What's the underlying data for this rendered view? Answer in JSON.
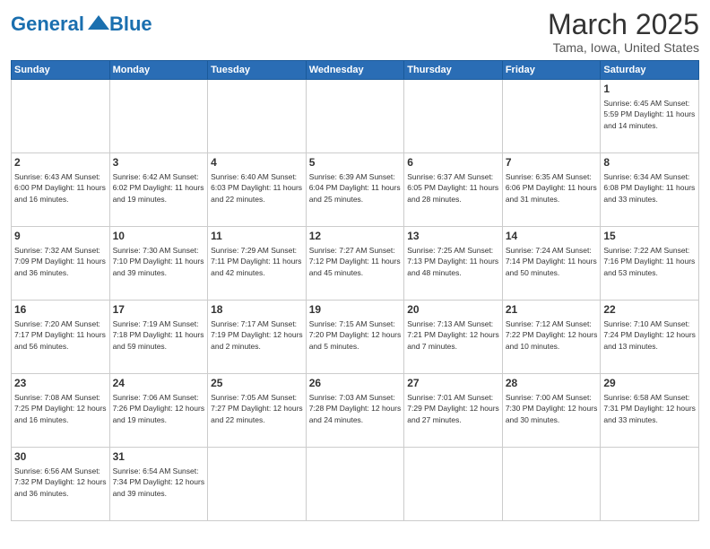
{
  "header": {
    "logo_text_normal": "General",
    "logo_text_blue": "Blue",
    "month_title": "March 2025",
    "location": "Tama, Iowa, United States"
  },
  "weekdays": [
    "Sunday",
    "Monday",
    "Tuesday",
    "Wednesday",
    "Thursday",
    "Friday",
    "Saturday"
  ],
  "weeks": [
    [
      {
        "day": "",
        "content": ""
      },
      {
        "day": "",
        "content": ""
      },
      {
        "day": "",
        "content": ""
      },
      {
        "day": "",
        "content": ""
      },
      {
        "day": "",
        "content": ""
      },
      {
        "day": "",
        "content": ""
      },
      {
        "day": "1",
        "content": "Sunrise: 6:45 AM\nSunset: 5:59 PM\nDaylight: 11 hours and 14 minutes."
      }
    ],
    [
      {
        "day": "2",
        "content": "Sunrise: 6:43 AM\nSunset: 6:00 PM\nDaylight: 11 hours and 16 minutes."
      },
      {
        "day": "3",
        "content": "Sunrise: 6:42 AM\nSunset: 6:02 PM\nDaylight: 11 hours and 19 minutes."
      },
      {
        "day": "4",
        "content": "Sunrise: 6:40 AM\nSunset: 6:03 PM\nDaylight: 11 hours and 22 minutes."
      },
      {
        "day": "5",
        "content": "Sunrise: 6:39 AM\nSunset: 6:04 PM\nDaylight: 11 hours and 25 minutes."
      },
      {
        "day": "6",
        "content": "Sunrise: 6:37 AM\nSunset: 6:05 PM\nDaylight: 11 hours and 28 minutes."
      },
      {
        "day": "7",
        "content": "Sunrise: 6:35 AM\nSunset: 6:06 PM\nDaylight: 11 hours and 31 minutes."
      },
      {
        "day": "8",
        "content": "Sunrise: 6:34 AM\nSunset: 6:08 PM\nDaylight: 11 hours and 33 minutes."
      }
    ],
    [
      {
        "day": "9",
        "content": "Sunrise: 7:32 AM\nSunset: 7:09 PM\nDaylight: 11 hours and 36 minutes."
      },
      {
        "day": "10",
        "content": "Sunrise: 7:30 AM\nSunset: 7:10 PM\nDaylight: 11 hours and 39 minutes."
      },
      {
        "day": "11",
        "content": "Sunrise: 7:29 AM\nSunset: 7:11 PM\nDaylight: 11 hours and 42 minutes."
      },
      {
        "day": "12",
        "content": "Sunrise: 7:27 AM\nSunset: 7:12 PM\nDaylight: 11 hours and 45 minutes."
      },
      {
        "day": "13",
        "content": "Sunrise: 7:25 AM\nSunset: 7:13 PM\nDaylight: 11 hours and 48 minutes."
      },
      {
        "day": "14",
        "content": "Sunrise: 7:24 AM\nSunset: 7:14 PM\nDaylight: 11 hours and 50 minutes."
      },
      {
        "day": "15",
        "content": "Sunrise: 7:22 AM\nSunset: 7:16 PM\nDaylight: 11 hours and 53 minutes."
      }
    ],
    [
      {
        "day": "16",
        "content": "Sunrise: 7:20 AM\nSunset: 7:17 PM\nDaylight: 11 hours and 56 minutes."
      },
      {
        "day": "17",
        "content": "Sunrise: 7:19 AM\nSunset: 7:18 PM\nDaylight: 11 hours and 59 minutes."
      },
      {
        "day": "18",
        "content": "Sunrise: 7:17 AM\nSunset: 7:19 PM\nDaylight: 12 hours and 2 minutes."
      },
      {
        "day": "19",
        "content": "Sunrise: 7:15 AM\nSunset: 7:20 PM\nDaylight: 12 hours and 5 minutes."
      },
      {
        "day": "20",
        "content": "Sunrise: 7:13 AM\nSunset: 7:21 PM\nDaylight: 12 hours and 7 minutes."
      },
      {
        "day": "21",
        "content": "Sunrise: 7:12 AM\nSunset: 7:22 PM\nDaylight: 12 hours and 10 minutes."
      },
      {
        "day": "22",
        "content": "Sunrise: 7:10 AM\nSunset: 7:24 PM\nDaylight: 12 hours and 13 minutes."
      }
    ],
    [
      {
        "day": "23",
        "content": "Sunrise: 7:08 AM\nSunset: 7:25 PM\nDaylight: 12 hours and 16 minutes."
      },
      {
        "day": "24",
        "content": "Sunrise: 7:06 AM\nSunset: 7:26 PM\nDaylight: 12 hours and 19 minutes."
      },
      {
        "day": "25",
        "content": "Sunrise: 7:05 AM\nSunset: 7:27 PM\nDaylight: 12 hours and 22 minutes."
      },
      {
        "day": "26",
        "content": "Sunrise: 7:03 AM\nSunset: 7:28 PM\nDaylight: 12 hours and 24 minutes."
      },
      {
        "day": "27",
        "content": "Sunrise: 7:01 AM\nSunset: 7:29 PM\nDaylight: 12 hours and 27 minutes."
      },
      {
        "day": "28",
        "content": "Sunrise: 7:00 AM\nSunset: 7:30 PM\nDaylight: 12 hours and 30 minutes."
      },
      {
        "day": "29",
        "content": "Sunrise: 6:58 AM\nSunset: 7:31 PM\nDaylight: 12 hours and 33 minutes."
      }
    ],
    [
      {
        "day": "30",
        "content": "Sunrise: 6:56 AM\nSunset: 7:32 PM\nDaylight: 12 hours and 36 minutes."
      },
      {
        "day": "31",
        "content": "Sunrise: 6:54 AM\nSunset: 7:34 PM\nDaylight: 12 hours and 39 minutes."
      },
      {
        "day": "",
        "content": ""
      },
      {
        "day": "",
        "content": ""
      },
      {
        "day": "",
        "content": ""
      },
      {
        "day": "",
        "content": ""
      },
      {
        "day": "",
        "content": ""
      }
    ]
  ]
}
